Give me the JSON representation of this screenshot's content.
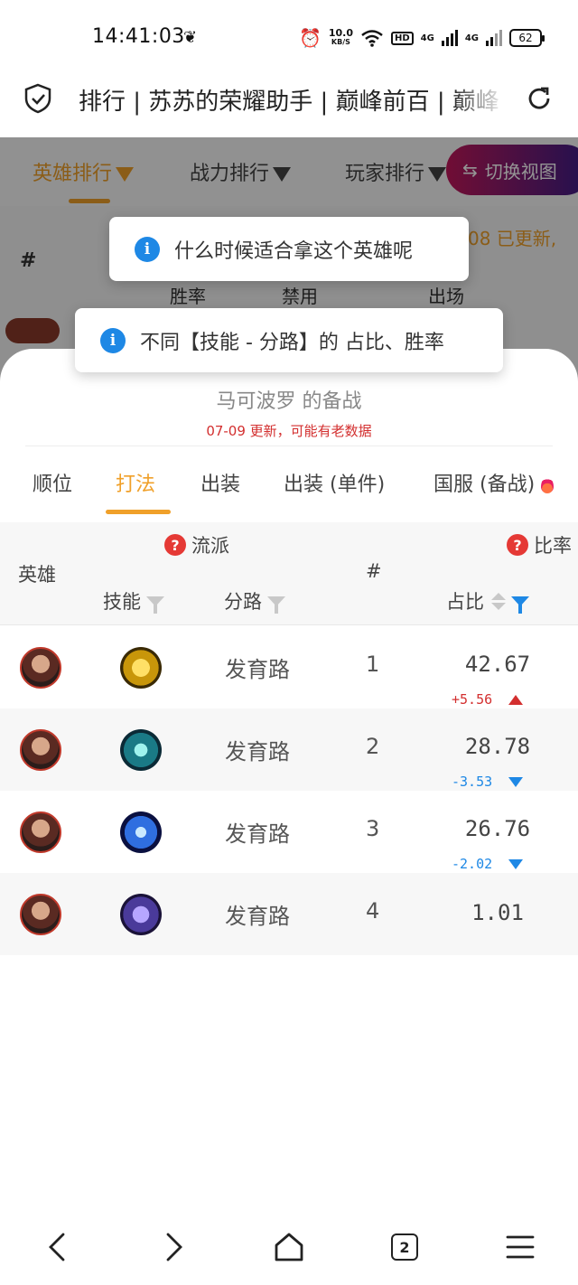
{
  "status_bar": {
    "time": "14:41:03",
    "net_speed_value": "10.0",
    "net_speed_unit": "KB/S",
    "hd_label": "HD",
    "sim1": "4G",
    "sim2": "4G",
    "battery": "62"
  },
  "address_bar": {
    "page_title": "排行 | 苏苏的荣耀助手 | 巅峰前百 | 巅峰"
  },
  "background_page": {
    "tabs": [
      "英雄排行",
      "战力排行",
      "玩家排行"
    ],
    "active_tab": 0,
    "switch_view": "切换视图",
    "hash": "#",
    "updated_text": "08  已更新,",
    "cols": [
      "胜率",
      "禁用",
      "出场"
    ]
  },
  "toasts": [
    {
      "text": "什么时候适合拿这个英雄呢"
    },
    {
      "text": "不同【技能 - 分路】的 占比、胜率"
    }
  ],
  "sheet": {
    "title": "马可波罗 的备战",
    "subtitle": "07-09 更新，可能有老数据",
    "tabs": [
      "顺位",
      "打法",
      "出装",
      "出装 (单件)",
      "国服 (备战)"
    ],
    "active_tab": 1
  },
  "table": {
    "header": {
      "hero": "英雄",
      "genre": "流派",
      "skill": "技能",
      "lane": "分路",
      "hash": "#",
      "ratio": "比率",
      "share": "占比"
    },
    "rows": [
      {
        "lane": "发育路",
        "rank": "1",
        "share": "42.67",
        "delta": "+5.56",
        "trend": "up",
        "skill_icon": "golden-fist-skill-icon"
      },
      {
        "lane": "发育路",
        "rank": "2",
        "share": "28.78",
        "delta": "-3.53",
        "trend": "down",
        "skill_icon": "flash-teal-skill-icon"
      },
      {
        "lane": "发育路",
        "rank": "3",
        "share": "26.76",
        "delta": "-2.02",
        "trend": "down",
        "skill_icon": "purify-lightning-skill-icon"
      },
      {
        "lane": "发育路",
        "rank": "4",
        "share": "1.01",
        "delta": "",
        "trend": "none",
        "skill_icon": "purple-hero-skill-icon"
      }
    ]
  },
  "bottom_nav": {
    "tab_count": "2"
  },
  "colors": {
    "accent": "#f0a02a",
    "info_blue": "#1e88e5",
    "up_red": "#d32f2f",
    "down_blue": "#1e88e5"
  }
}
